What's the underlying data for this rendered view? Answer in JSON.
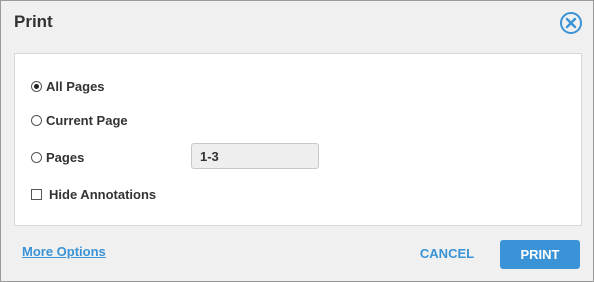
{
  "dialog": {
    "title": "Print",
    "close_icon": "close-circle-icon"
  },
  "options": {
    "all_pages": {
      "label": "All Pages",
      "checked": true
    },
    "current_page": {
      "label": "Current Page",
      "checked": false
    },
    "pages": {
      "label": "Pages",
      "checked": false,
      "range_value": "1-3"
    },
    "hide_annotations": {
      "label": "Hide Annotations",
      "checked": false
    }
  },
  "footer": {
    "more_options_label": "More Options",
    "cancel_label": "CANCEL",
    "print_label": "PRINT"
  },
  "colors": {
    "accent": "#3a93d6",
    "background": "#f0f0f0",
    "panel": "#ffffff"
  }
}
